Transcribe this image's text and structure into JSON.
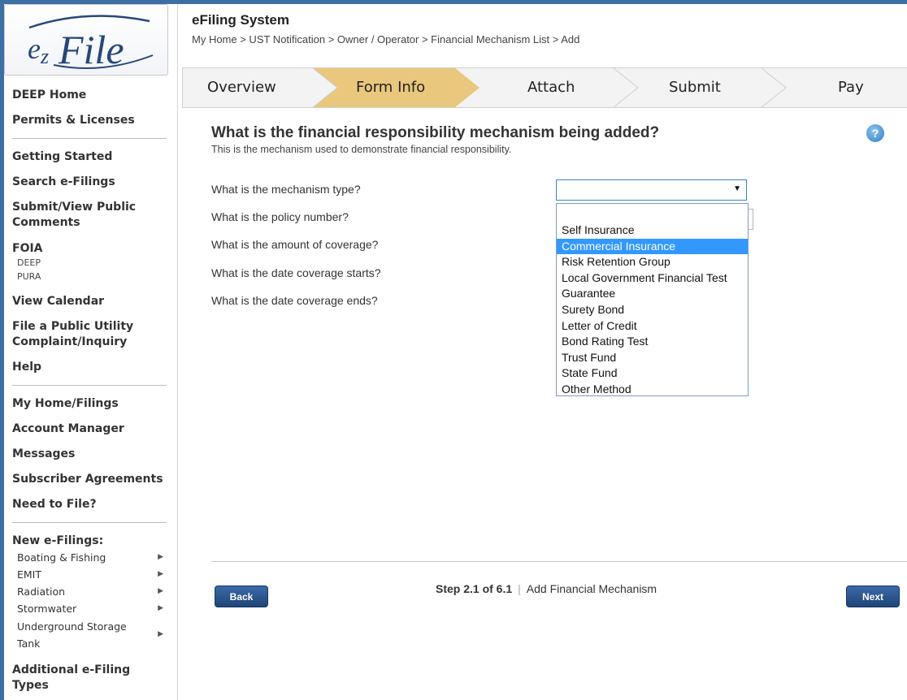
{
  "sidebar": {
    "logo_text": "ezFile",
    "group1": [
      "DEEP Home",
      "Permits & Licenses"
    ],
    "group2": {
      "getting_started": "Getting Started",
      "search": "Search e-Filings",
      "comments_line1": "Submit/View Public",
      "comments_line2": "Comments",
      "foia": "FOIA",
      "foia_deep": "DEEP",
      "foia_pura": "PURA",
      "calendar": "View Calendar",
      "complaint_line1": "File a Public Utility",
      "complaint_line2": "Complaint/Inquiry",
      "help": "Help"
    },
    "group3": [
      "My Home/Filings",
      "Account Manager",
      "Messages",
      "Subscriber Agreements",
      "Need to File?"
    ],
    "new_filings_title": "New e-Filings:",
    "new_filings": {
      "boating": "Boating & Fishing",
      "emit": "EMIT",
      "radiation": "Radiation",
      "stormwater": "Stormwater",
      "ust_line1": "Underground Storage",
      "ust_line2": "Tank"
    },
    "additional_line1": "Additional e-Filing",
    "additional_line2": "Types"
  },
  "header": {
    "title": "eFiling System",
    "breadcrumb": "My Home > UST Notification > Owner / Operator >  Financial Mechanism List > Add"
  },
  "steps": [
    "Overview",
    "Form Info",
    "Attach",
    "Submit",
    "Pay"
  ],
  "colors": {
    "active_step": "#e9c77c",
    "accent": "#3298fe",
    "button": "#2a5590",
    "frame": "#3d6fa3"
  },
  "form": {
    "question": "What is the financial responsibility mechanism being added?",
    "subtitle": "This is the mechanism used to demonstrate financial responsibility.",
    "labels": {
      "type": "What is the mechanism type?",
      "policy": "What is the policy number?",
      "amount": "What is the amount of coverage?",
      "start": "What is the date coverage starts?",
      "end": "What is the date coverage ends?"
    },
    "mechanism_type_value": "",
    "options": [
      "",
      "Self Insurance",
      "Commercial Insurance",
      "Risk Retention Group",
      "Local Government Financial Test",
      "Guarantee",
      "Surety Bond",
      "Letter of Credit",
      "Bond Rating Test",
      "Trust Fund",
      "State Fund",
      "Other Method"
    ],
    "highlighted_option": "Commercial Insurance"
  },
  "footer": {
    "back": "Back",
    "next": "Next",
    "step_bold": "Step 2.1 of 6.1",
    "step_label": "Add Financial Mechanism"
  },
  "icons": {
    "help": "help-icon",
    "dropdown_caret": "▼",
    "submenu_arrow": "▸"
  }
}
